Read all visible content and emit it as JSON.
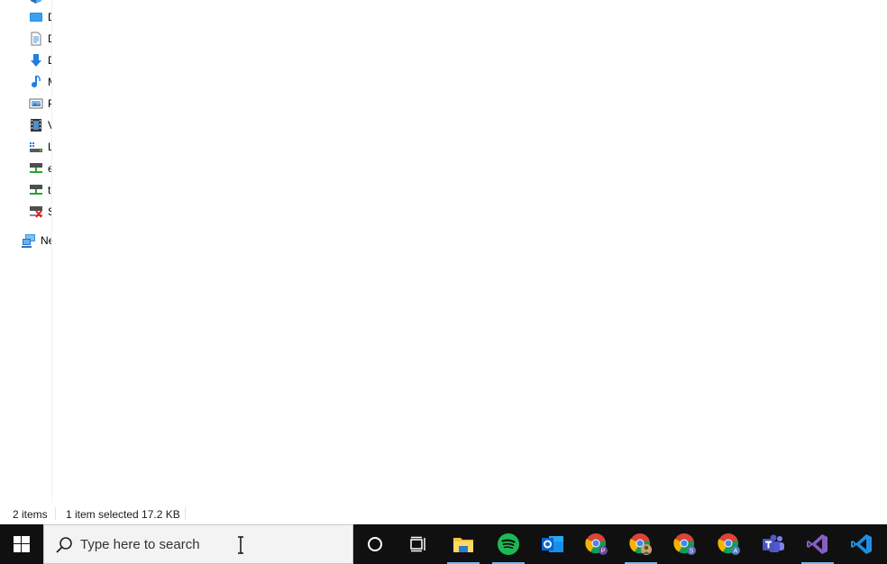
{
  "nav_pane": {
    "items": [
      {
        "label": "D",
        "icon": "desktop-icon"
      },
      {
        "label": "D",
        "icon": "documents-icon"
      },
      {
        "label": "D",
        "icon": "downloads-icon"
      },
      {
        "label": "M",
        "icon": "music-icon"
      },
      {
        "label": "P",
        "icon": "pictures-icon"
      },
      {
        "label": "V",
        "icon": "videos-icon"
      },
      {
        "label": "L",
        "icon": "local-disk-icon"
      },
      {
        "label": "e",
        "icon": "network-drive-icon"
      },
      {
        "label": "t",
        "icon": "network-drive-icon"
      },
      {
        "label": "S",
        "icon": "disconnected-drive-icon"
      }
    ],
    "network": {
      "label": "Ne",
      "icon": "network-icon"
    }
  },
  "status_bar": {
    "item_count": "2 items",
    "selection": "1 item selected  17.2 KB"
  },
  "taskbar": {
    "search_placeholder": "Type here to search",
    "apps": [
      {
        "name": "cortana",
        "active": false
      },
      {
        "name": "task-view",
        "active": false
      },
      {
        "name": "file-explorer",
        "active": true
      },
      {
        "name": "spotify",
        "active": true
      },
      {
        "name": "outlook",
        "active": false
      },
      {
        "name": "chrome-profile-p",
        "active": false
      },
      {
        "name": "chrome-profile-user",
        "active": true
      },
      {
        "name": "chrome-profile-s",
        "active": false
      },
      {
        "name": "chrome-profile-a",
        "active": false
      },
      {
        "name": "teams",
        "active": false
      },
      {
        "name": "visual-studio",
        "active": true
      },
      {
        "name": "vscode",
        "active": false
      }
    ]
  },
  "colors": {
    "taskbar_bg": "#101010",
    "active_indicator": "#76b9ed",
    "spotify": "#1db954",
    "outlook": "#0a64d6",
    "vs": "#865fc5",
    "vscode": "#1e8fe0",
    "teams": "#5059c9"
  }
}
